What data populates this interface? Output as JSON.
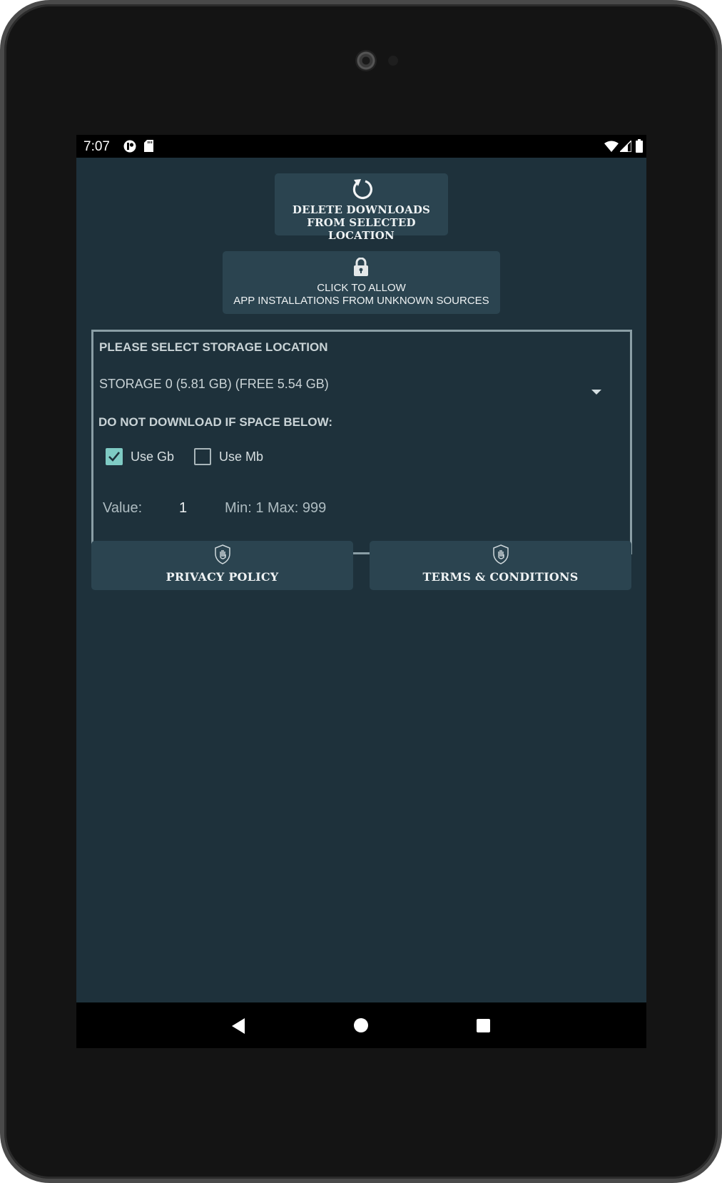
{
  "status_bar": {
    "time": "7:07",
    "left_icons": [
      "app-notification-icon",
      "sd-card-icon"
    ],
    "right_icons": [
      "wifi-icon",
      "cell-signal-icon",
      "battery-icon"
    ]
  },
  "buttons": {
    "delete_downloads": {
      "icon": "refresh-icon",
      "line1": "DELETE DOWNLOADS",
      "line2": "FROM SELECTED LOCATION"
    },
    "allow_unknown": {
      "icon": "lock-icon",
      "line1": "CLICK TO ALLOW",
      "line2": "APP INSTALLATIONS FROM UNKNOWN SOURCES"
    },
    "privacy_policy": {
      "icon": "shield-hand-icon",
      "label": "PRIVACY POLICY"
    },
    "terms": {
      "icon": "shield-hand-icon",
      "label": "TERMS & CONDITIONS"
    }
  },
  "storage": {
    "heading": "PLEASE SELECT STORAGE LOCATION",
    "selected_location": "STORAGE 0 (5.81 GB) (FREE 5.54 GB)",
    "threshold_heading": "DO NOT DOWNLOAD IF SPACE BELOW:",
    "units": [
      {
        "label": "Use Gb",
        "checked": true
      },
      {
        "label": "Use Mb",
        "checked": false
      }
    ],
    "value_label": "Value:",
    "value": "1",
    "range_text": "Min: 1 Max: 999"
  },
  "colors": {
    "background": "#1e313b",
    "button": "#2b4450",
    "checkbox_accent": "#7fcbc4",
    "border": "#8a9ea5"
  },
  "nav_bar": [
    "back-button",
    "home-button",
    "recents-button"
  ]
}
